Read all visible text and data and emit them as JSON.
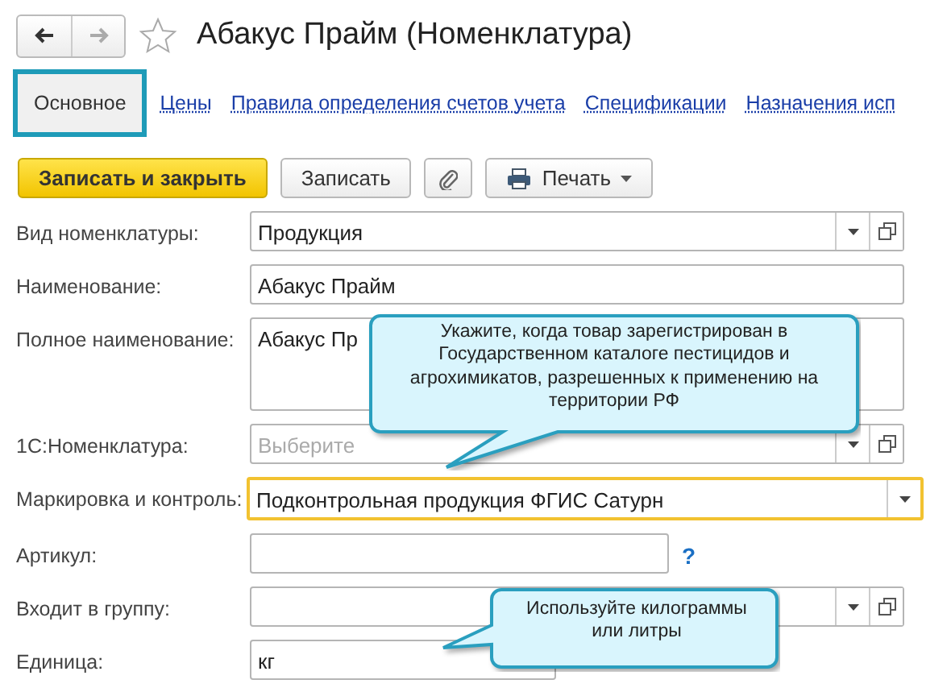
{
  "title": "Абакус Прайм (Номенклатура)",
  "favorite": false,
  "tabs": [
    {
      "label": "Основное",
      "selected": true
    },
    {
      "label": "Цены",
      "selected": false
    },
    {
      "label": "Правила определения счетов учета",
      "selected": false
    },
    {
      "label": "Спецификации",
      "selected": false
    },
    {
      "label": "Назначения исп",
      "selected": false
    }
  ],
  "toolbar": [
    {
      "kind": "primary",
      "label": "Записать и закрыть"
    },
    {
      "kind": "plain",
      "label": "Записать"
    },
    {
      "kind": "attach"
    },
    {
      "kind": "print",
      "label": "Печать"
    }
  ],
  "fields": [
    {
      "label": "Вид номенклатуры:",
      "kind": "select",
      "value": "Продукция",
      "highlighted": false
    },
    {
      "label": "Наименование:",
      "kind": "text",
      "value": "Абакус Прайм",
      "highlighted": false
    },
    {
      "label": "Полное наименование:",
      "kind": "textarea",
      "value": "Абакус Пр",
      "highlighted": false
    },
    {
      "label": "1С:Номенклатура:",
      "kind": "select",
      "placeholder": "Выберите",
      "highlighted": false
    },
    {
      "label": "Маркировка и контроль:",
      "kind": "dropdown",
      "value": "Подконтрольная продукция ФГИС Сатурн",
      "highlighted": true
    },
    {
      "label": "Артикул:",
      "kind": "help",
      "help": "?",
      "highlighted": false
    },
    {
      "label": "Входит в группу:",
      "kind": "select",
      "highlighted": false
    },
    {
      "label": "Единица:",
      "kind": "short",
      "value": "кг",
      "highlighted": false
    }
  ],
  "callouts": [
    {
      "text": "Укажите, когда товар зарегистрирован в Государственном каталоге пестицидов и агрохимикатов, разрешенных к применению на территории РФ",
      "kind": "down"
    },
    {
      "text": "Используйте килограммы или литры",
      "kind": "left"
    }
  ]
}
